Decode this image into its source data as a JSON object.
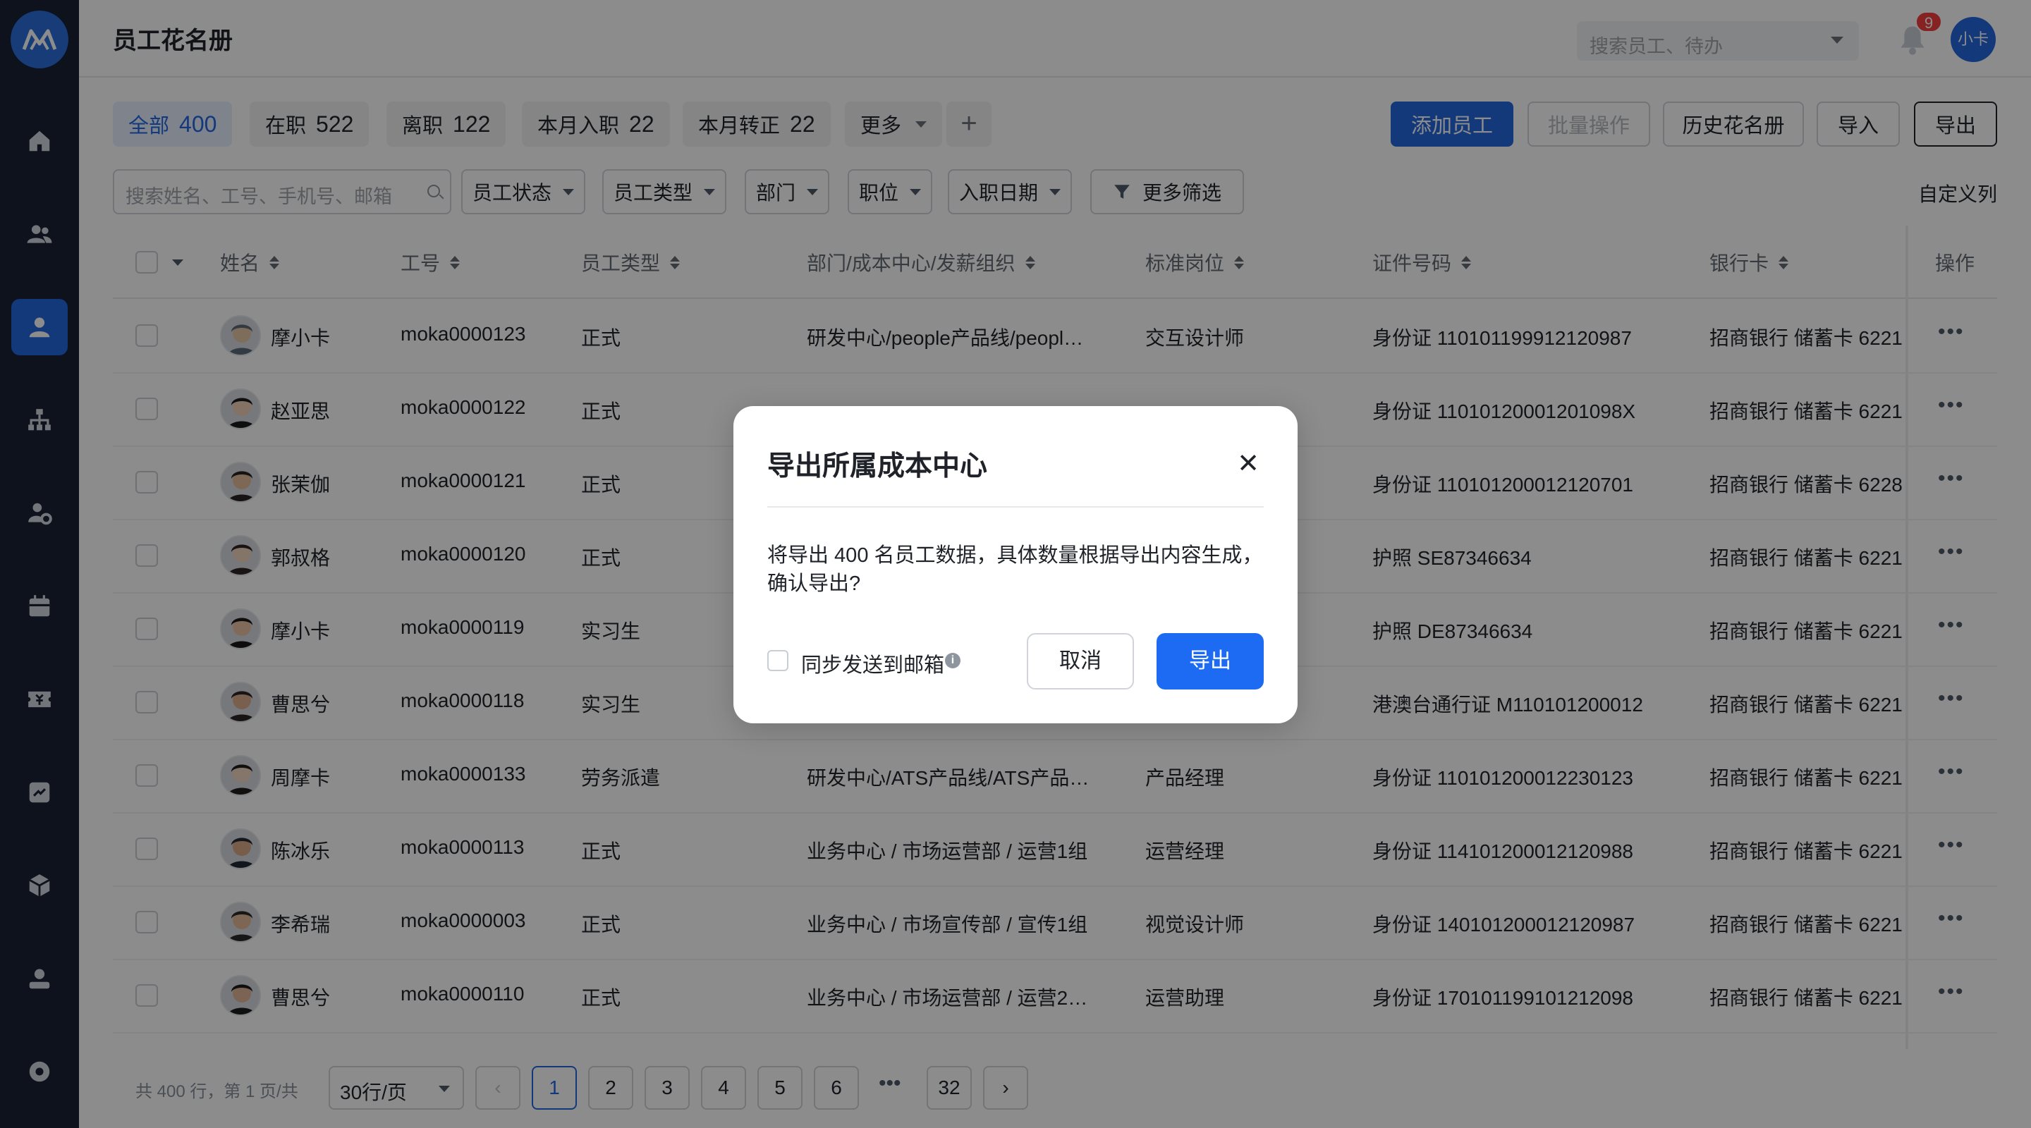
{
  "header": {
    "title": "员工花名册",
    "search_placeholder": "搜索员工、待办",
    "notification_count": "9",
    "user_avatar": "小卡"
  },
  "tabs": [
    {
      "label": "全部",
      "count": "400"
    },
    {
      "label": "在职",
      "count": "522"
    },
    {
      "label": "离职",
      "count": "122"
    },
    {
      "label": "本月入职",
      "count": "22"
    },
    {
      "label": "本月转正",
      "count": "22"
    },
    {
      "label": "更多",
      "count": ""
    }
  ],
  "toolbar": {
    "add": "添加员工",
    "batch": "批量操作",
    "history": "历史花名册",
    "import": "导入",
    "export": "导出"
  },
  "filters": {
    "search_placeholder": "搜索姓名、工号、手机号、邮箱",
    "status": "员工状态",
    "type": "员工类型",
    "dept": "部门",
    "position": "职位",
    "hire_date": "入职日期",
    "more": "更多筛选",
    "custom_columns": "自定义列"
  },
  "table": {
    "columns": [
      "姓名",
      "工号",
      "员工类型",
      "部门/成本中心/发薪组织",
      "标准岗位",
      "证件号码",
      "银行卡",
      "操作"
    ],
    "rows": [
      {
        "name": "摩小卡",
        "id": "moka0000123",
        "type": "正式",
        "dept": "研发中心/people产品线/peopl…",
        "position": "交互设计师",
        "cert": "身份证 110101199912120987",
        "bank": "招商银行 储蓄卡 6221"
      },
      {
        "name": "赵亚思",
        "id": "moka0000122",
        "type": "正式",
        "dept": "",
        "position": "",
        "cert": "身份证 11010120001201098X",
        "bank": "招商银行 储蓄卡 6221"
      },
      {
        "name": "张茉伽",
        "id": "moka0000121",
        "type": "正式",
        "dept": "",
        "position": "",
        "cert": "身份证 110101200012120701",
        "bank": "招商银行 储蓄卡 6228"
      },
      {
        "name": "郭叔格",
        "id": "moka0000120",
        "type": "正式",
        "dept": "",
        "position": "",
        "cert": "护照 SE87346634",
        "bank": "招商银行 储蓄卡 6221"
      },
      {
        "name": "摩小卡",
        "id": "moka0000119",
        "type": "实习生",
        "dept": "",
        "position": "",
        "cert": "护照 DE87346634",
        "bank": "招商银行 储蓄卡 6221"
      },
      {
        "name": "曹思兮",
        "id": "moka0000118",
        "type": "实习生",
        "dept": "",
        "position": "",
        "cert": "港澳台通行证 M110101200012",
        "bank": "招商银行 储蓄卡 6221"
      },
      {
        "name": "周摩卡",
        "id": "moka0000133",
        "type": "劳务派遣",
        "dept": "研发中心/ATS产品线/ATS产品…",
        "position": "产品经理",
        "cert": "身份证 110101200012230123",
        "bank": "招商银行 储蓄卡 6221"
      },
      {
        "name": "陈冰乐",
        "id": "moka0000113",
        "type": "正式",
        "dept": "业务中心 / 市场运营部 / 运营1组",
        "position": "运营经理",
        "cert": "身份证 114101200012120988",
        "bank": "招商银行 储蓄卡 6221"
      },
      {
        "name": "李希瑞",
        "id": "moka0000003",
        "type": "正式",
        "dept": "业务中心 / 市场宣传部 / 宣传1组",
        "position": "视觉设计师",
        "cert": "身份证 140101200012120987",
        "bank": "招商银行 储蓄卡 6221"
      },
      {
        "name": "曹思兮",
        "id": "moka0000110",
        "type": "正式",
        "dept": "业务中心 / 市场运营部 / 运营2…",
        "position": "运营助理",
        "cert": "身份证 170101199101212098",
        "bank": "招商银行 储蓄卡 6221"
      }
    ]
  },
  "pagination": {
    "info": "共 400 行，第 1 页/共",
    "page_size": "30行/页",
    "pages": [
      "1",
      "2",
      "3",
      "4",
      "5",
      "6",
      "32"
    ],
    "ellipsis": "•••",
    "prev": "‹",
    "next": "›"
  },
  "modal": {
    "title": "导出所属成本中心",
    "message": "将导出 400 名员工数据，具体数量根据导出内容生成，确认导出?",
    "checkbox_label": "同步发送到邮箱",
    "cancel": "取消",
    "confirm": "导出"
  },
  "colors": {
    "primary": "#2568e0",
    "sidebar": "#182234",
    "danger": "#f53f3f"
  }
}
